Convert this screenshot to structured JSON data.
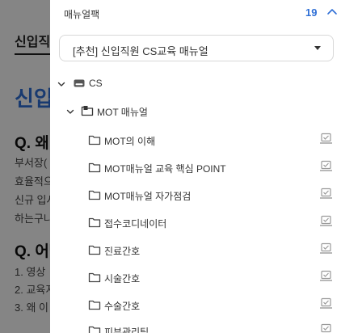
{
  "background_page": {
    "breadcrumb": "신입직원",
    "title": "신입",
    "section1_heading": "Q. 왜",
    "section1_lines": [
      "부서장(",
      "효율적으",
      "신규 입사",
      "하는구나"
    ],
    "section2_heading": "Q. 어떻",
    "section2_lines": [
      "1. 영상 ",
      "2. 교육지",
      "3. 왜 이"
    ]
  },
  "drawer": {
    "title": "매뉴얼팩",
    "count": "19",
    "selected_pack": "[추천] 신입직원 CS교육 매뉴얼",
    "tree": {
      "root": {
        "label": "CS",
        "icon": "drive-icon",
        "expanded": true
      },
      "folder": {
        "label": "MOT 매뉴얼",
        "icon": "folder-share-icon",
        "expanded": true
      },
      "items": [
        {
          "label": "MOT의 이해",
          "icon": "folder-icon",
          "action_icon": "checklist-icon"
        },
        {
          "label": "MOT매뉴얼 교육 핵심 POINT",
          "icon": "folder-icon",
          "action_icon": "checklist-icon"
        },
        {
          "label": "MOT매뉴얼 자가점검",
          "icon": "folder-icon",
          "action_icon": "checklist-icon"
        },
        {
          "label": "접수코디네이터",
          "icon": "folder-icon",
          "action_icon": "checklist-icon"
        },
        {
          "label": "진료간호",
          "icon": "folder-icon",
          "action_icon": "checklist-icon"
        },
        {
          "label": "시술간호",
          "icon": "folder-icon",
          "action_icon": "checklist-icon"
        },
        {
          "label": "수술간호",
          "icon": "folder-icon",
          "action_icon": "checklist-icon"
        },
        {
          "label": "피부관리팀",
          "icon": "folder-icon",
          "action_icon": "checklist-icon"
        }
      ]
    }
  },
  "colors": {
    "accent": "#2f6fd6",
    "overlay": "rgba(0,0,0,0.48)",
    "text": "#333333",
    "icon": "#555555",
    "action_icon": "#9a9a9a"
  }
}
